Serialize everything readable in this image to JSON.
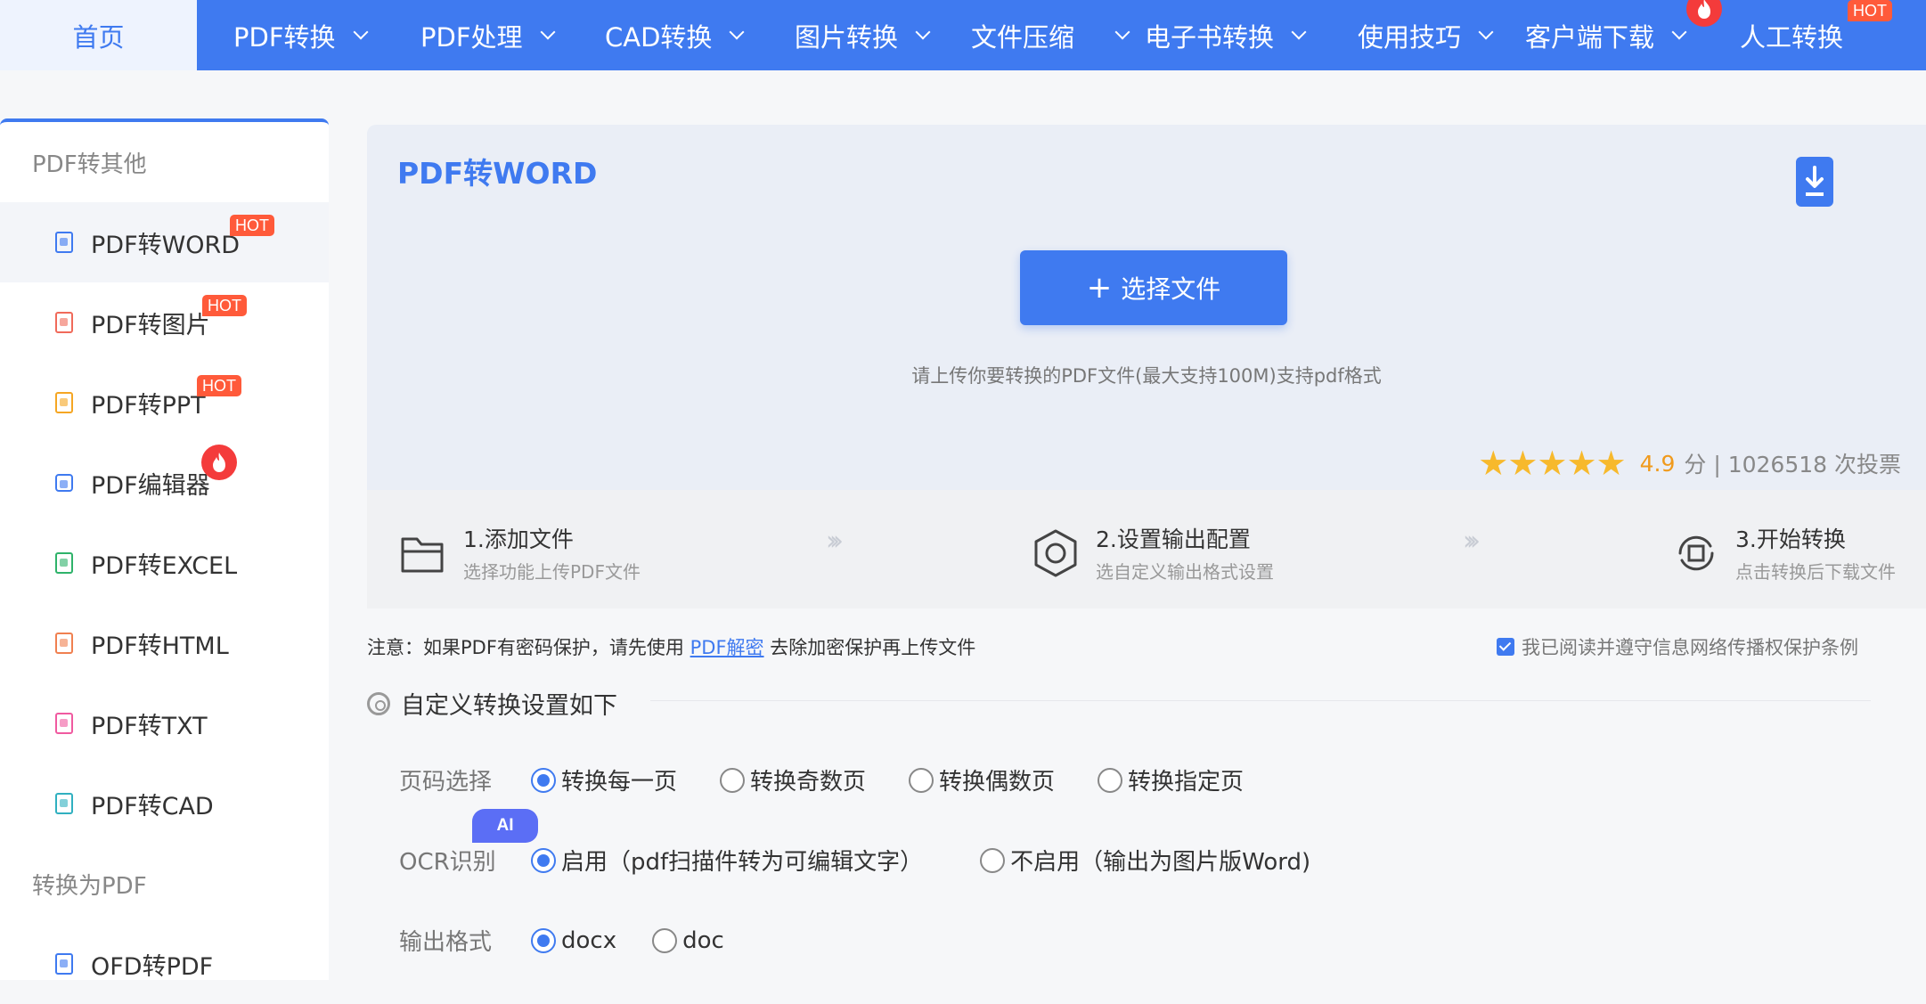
{
  "nav": {
    "home": "首页",
    "items": [
      {
        "label": "PDF转换"
      },
      {
        "label": "PDF处理"
      },
      {
        "label": "CAD转换"
      },
      {
        "label": "图片转换"
      },
      {
        "label": "文件压缩"
      },
      {
        "label": "电子书转换"
      },
      {
        "label": "使用技巧"
      },
      {
        "label": "客户端下载"
      },
      {
        "label": "人工转换"
      }
    ],
    "hot_tag": "HOT"
  },
  "sidebar": {
    "group1": "PDF转其他",
    "items": [
      {
        "label": "PDF转WORD",
        "color": "#3f7af0"
      },
      {
        "label": "PDF转图片",
        "color": "#f06a5a"
      },
      {
        "label": "PDF转PPT",
        "color": "#f5a623"
      },
      {
        "label": "PDF编辑器",
        "color": "#3f7af0"
      },
      {
        "label": "PDF转EXCEL",
        "color": "#2fb36a"
      },
      {
        "label": "PDF转HTML",
        "color": "#f08050"
      },
      {
        "label": "PDF转TXT",
        "color": "#f05aa0"
      },
      {
        "label": "PDF转CAD",
        "color": "#30b0c0"
      }
    ],
    "group2": "转换为PDF",
    "items2": [
      {
        "label": "OFD转PDF",
        "color": "#3f7af0"
      }
    ],
    "hot_tag": "HOT"
  },
  "upload": {
    "title": "PDF转WORD",
    "button": "选择文件",
    "hint": "请上传你要转换的PDF文件(最大支持100M)支持pdf格式",
    "stars": "★★★★★",
    "score": "4.9",
    "rating_text": "分 | 1026518 次投票"
  },
  "steps": [
    {
      "title": "1.添加文件",
      "sub": "选择功能上传PDF文件"
    },
    {
      "title": "2.设置输出配置",
      "sub": "选自定义输出格式设置"
    },
    {
      "title": "3.开始转换",
      "sub": "点击转换后下载文件"
    }
  ],
  "notice": {
    "prefix": "注意：如果PDF有密码保护，请先使用",
    "link": "PDF解密",
    "suffix": "去除加密保护再上传文件",
    "agree": "我已阅读并遵守信息网络传播权保护条例"
  },
  "settings": {
    "title": "自定义转换设置如下",
    "pages_label": "页码选择",
    "pages_options": [
      "转换每一页",
      "转换奇数页",
      "转换偶数页",
      "转换指定页"
    ],
    "ocr_label": "OCR识别",
    "ocr_options": [
      "启用（pdf扫描件转为可编辑文字）",
      "不启用（输出为图片版Word)"
    ],
    "format_label": "输出格式",
    "format_options": [
      "docx",
      "doc"
    ],
    "ai_badge": "AI"
  }
}
